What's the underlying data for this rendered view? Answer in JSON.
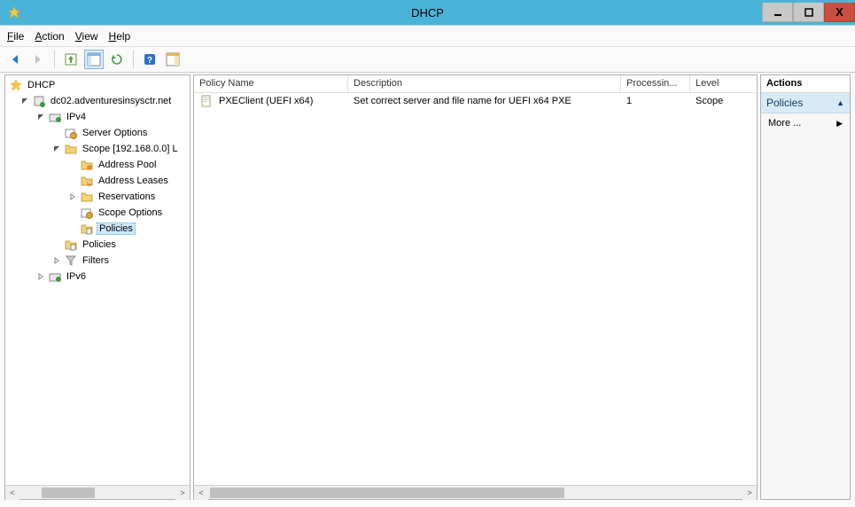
{
  "window": {
    "title": "DHCP"
  },
  "menu": {
    "file": "File",
    "action": "Action",
    "view": "View",
    "help": "Help"
  },
  "tree": {
    "root": "DHCP",
    "server": "dc02.adventuresinsysctr.net",
    "ipv4": "IPv4",
    "serverOptions": "Server Options",
    "scope": "Scope [192.168.0.0] L",
    "addressPool": "Address Pool",
    "addressLeases": "Address Leases",
    "reservations": "Reservations",
    "scopeOptions": "Scope Options",
    "scopePolicies": "Policies",
    "policies": "Policies",
    "filters": "Filters",
    "ipv6": "IPv6"
  },
  "list": {
    "columns": {
      "name": "Policy Name",
      "description": "Description",
      "processing": "Processin...",
      "level": "Level"
    },
    "rows": [
      {
        "name": "PXEClient (UEFI x64)",
        "description": "Set correct server and file name for UEFI x64 PXE",
        "processing": "1",
        "level": "Scope"
      }
    ]
  },
  "actions": {
    "header": "Actions",
    "group": "Policies",
    "more": "More ..."
  }
}
